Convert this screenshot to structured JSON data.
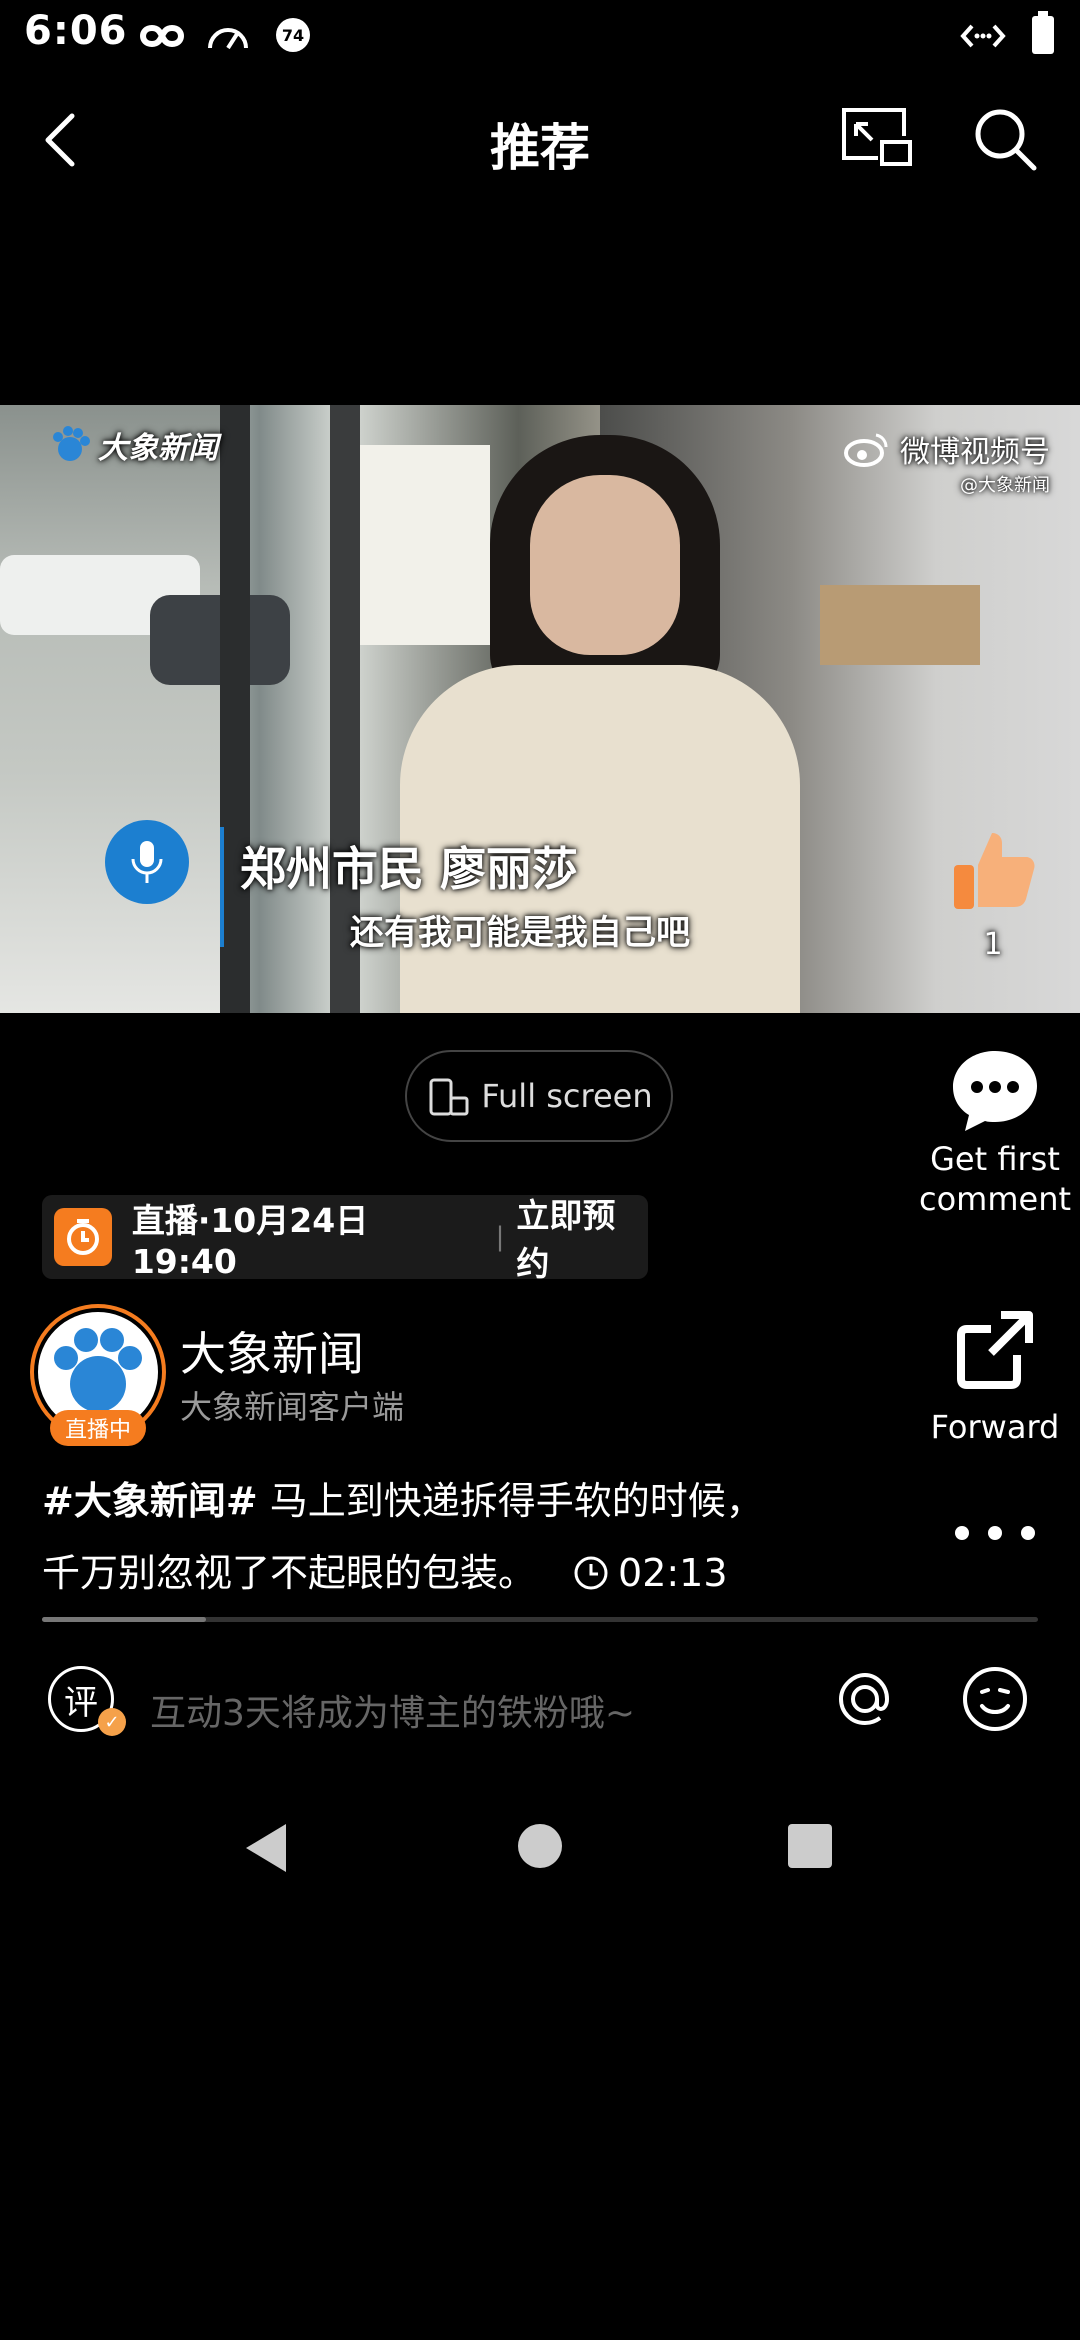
{
  "status_bar": {
    "time": "6:06",
    "battery_level": 1.0,
    "icons": [
      "infinity-icon",
      "speed-gauge-icon",
      "notification-badge-icon",
      "code-brackets-icon",
      "battery-icon"
    ],
    "badge_number": "74"
  },
  "header": {
    "title": "推荐",
    "icons": [
      "back-arrow-icon",
      "picture-in-picture-icon",
      "search-icon"
    ]
  },
  "video": {
    "logo_text": "大象新闻",
    "watermark_main": "微博视频号",
    "watermark_sub": "@大象新闻",
    "caption_name": "郑州市民 廖丽莎",
    "caption_quote": "还有我可能是我自己吧",
    "like_count": "1"
  },
  "actions": {
    "fullscreen_label": "Full screen",
    "comment_label_line1": "Get first",
    "comment_label_line2": "comment",
    "forward_label": "Forward"
  },
  "live_banner": {
    "text": "直播·10月24日 19:40",
    "divider": "|",
    "action": "立即预约"
  },
  "author": {
    "name": "大象新闻",
    "subtitle": "大象新闻客户端",
    "live_badge": "直播中"
  },
  "post": {
    "hashtag": "#大象新闻#",
    "text_line1": " 马上到快递拆得手软的时候，",
    "text_line2": "千万别忽视了不起眼的包装。",
    "duration": "02:13",
    "progress_fraction": 0.165
  },
  "comment_bar": {
    "badge_char": "评",
    "placeholder": "互动3天将成为博主的铁粉哦~"
  },
  "colors": {
    "accent_orange": "#f57c1f",
    "background": "#000000",
    "muted_text": "#9a9a9a"
  }
}
